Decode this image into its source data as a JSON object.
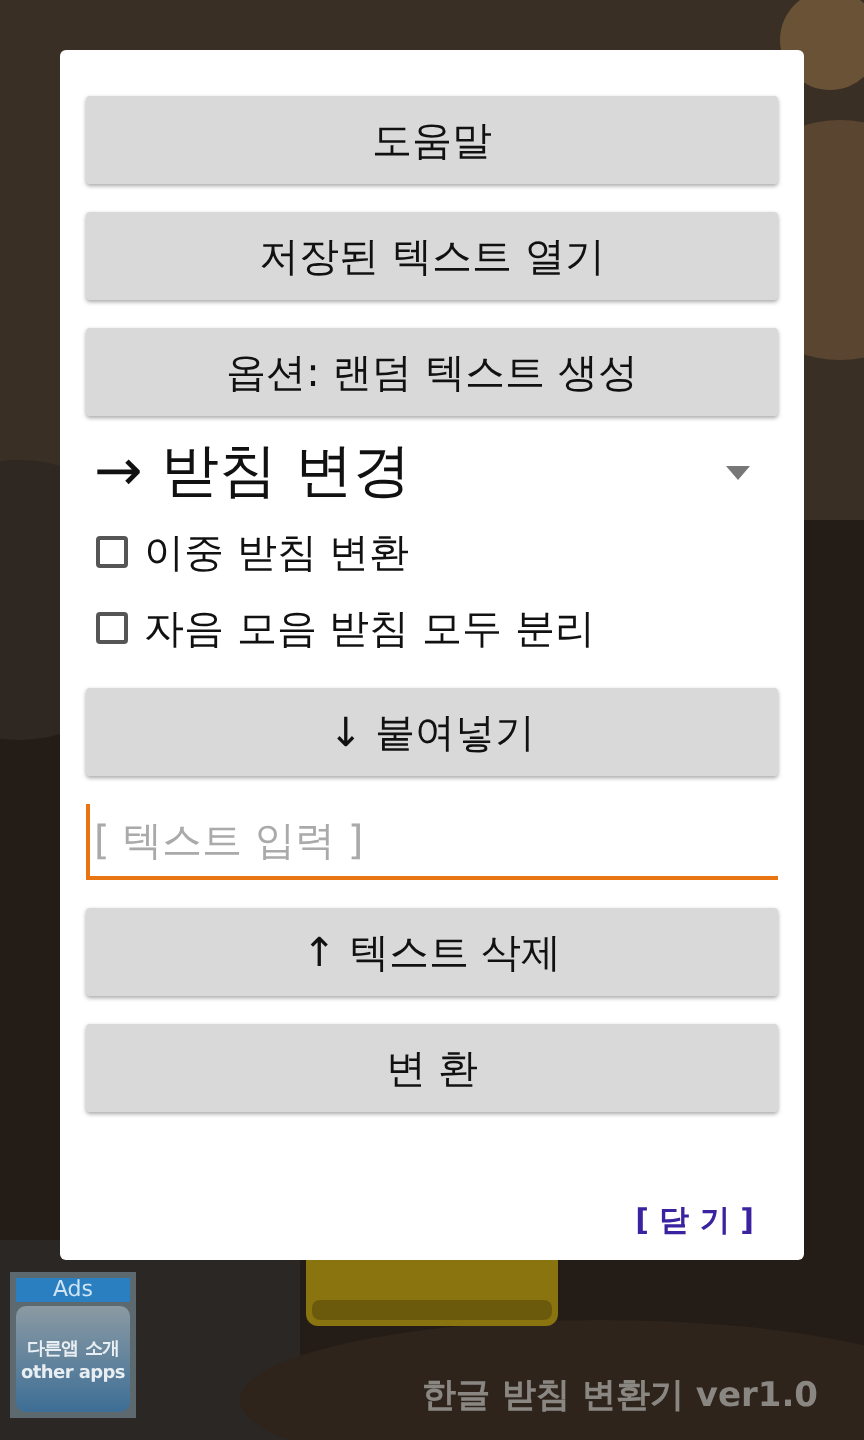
{
  "dialog": {
    "buttons": [
      "도움말",
      "저장된 텍스트 열기",
      "옵션: 랜덤 텍스트 생성"
    ],
    "mode_select": {
      "value": "→ 받침 변경"
    },
    "options": [
      {
        "label": "이중 받침 변환",
        "checked": false
      },
      {
        "label": "자음 모음 받침 모두 분리",
        "checked": false
      }
    ],
    "paste_button": "↓ 붙여넣기",
    "input": {
      "placeholder": "[ 텍스트 입력 ]"
    },
    "delete_button": "↑ 텍스트 삭제",
    "convert_button": "변 환",
    "close_link": "[ 닫 기 ]"
  },
  "ads": {
    "header": "Ads",
    "label_ko": "다른앱 소개",
    "label_en": "other apps"
  },
  "app_title": "한글 받침 변환기 ver1.0"
}
